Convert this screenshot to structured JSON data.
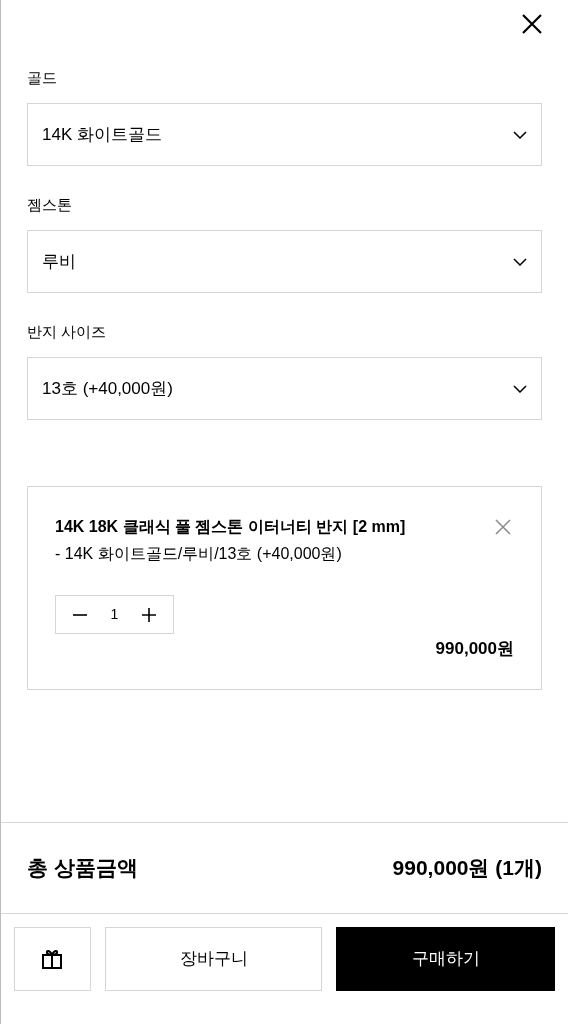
{
  "options": [
    {
      "label": "골드",
      "value": "14K 화이트골드"
    },
    {
      "label": "젬스톤",
      "value": "루비"
    },
    {
      "label": "반지 사이즈",
      "value": "13호 (+40,000원)"
    }
  ],
  "selected_item": {
    "name": "14K 18K 클래식 풀 젬스톤 이터너티 반지 [2 mm]",
    "option": "- 14K 화이트골드/루비/13호 (+40,000원)",
    "quantity": "1",
    "price": "990,000원"
  },
  "total": {
    "label": "총 상품금액",
    "amount": "990,000원 (1개)"
  },
  "buttons": {
    "cart": "장바구니",
    "buy": "구매하기"
  }
}
